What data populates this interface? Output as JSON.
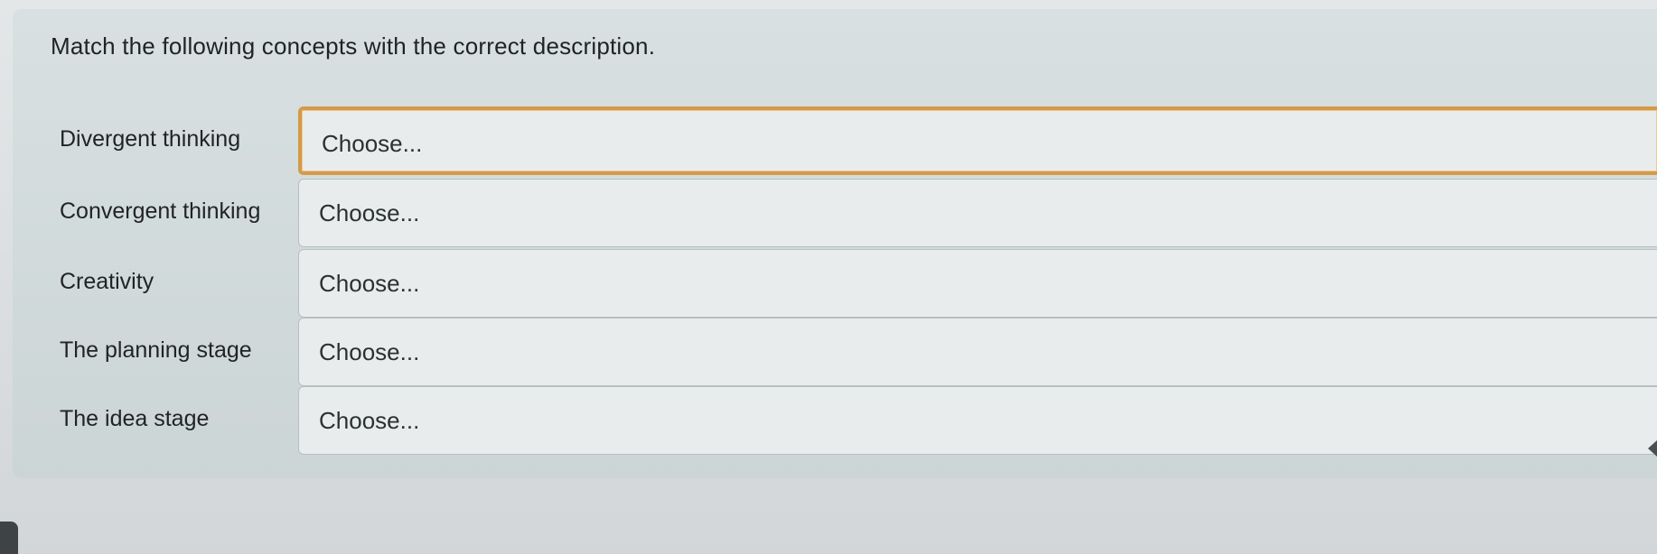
{
  "question": {
    "prompt": "Match the following concepts with the correct description."
  },
  "rows": [
    {
      "label": "Divergent thinking",
      "value": "Choose..."
    },
    {
      "label": "Convergent thinking",
      "value": "Choose..."
    },
    {
      "label": "Creativity",
      "value": "Choose..."
    },
    {
      "label": "The planning stage",
      "value": "Choose..."
    },
    {
      "label": "The idea stage",
      "value": "Choose..."
    }
  ],
  "colors": {
    "focus_border": "#d39a49",
    "card_background": "#d3dbdc",
    "select_background": "#e9ecec"
  }
}
